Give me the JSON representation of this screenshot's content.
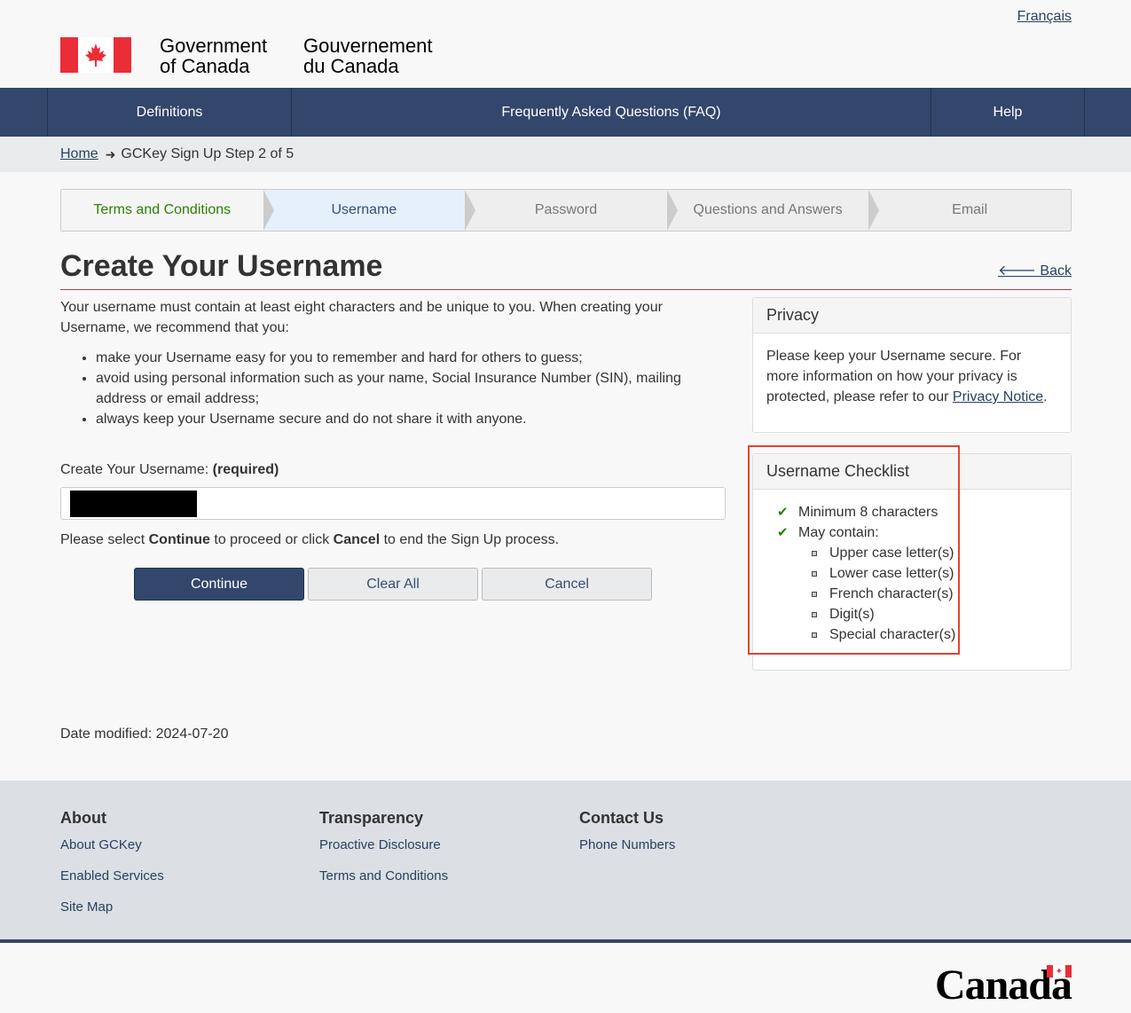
{
  "header": {
    "lang_link": "Français",
    "signature_en_line1": "Government",
    "signature_en_line2": "of Canada",
    "signature_fr_line1": "Gouvernement",
    "signature_fr_line2": "du Canada"
  },
  "nav": {
    "definitions": "Definitions",
    "faq": "Frequently Asked Questions (FAQ)",
    "help": "Help"
  },
  "breadcrumb": {
    "home": "Home",
    "current": "GCKey Sign Up Step 2 of 5"
  },
  "steps": [
    {
      "label": "Terms and Conditions",
      "state": "done"
    },
    {
      "label": "Username",
      "state": "active"
    },
    {
      "label": "Password",
      "state": "upcoming"
    },
    {
      "label": "Questions and Answers",
      "state": "upcoming"
    },
    {
      "label": "Email",
      "state": "upcoming"
    }
  ],
  "page": {
    "title": "Create Your Username",
    "back": "Back",
    "intro": "Your username must contain at least eight characters and be unique to you. When creating your Username, we recommend that you:",
    "bullets": [
      "make your Username easy for you to remember and hard for others to guess;",
      "avoid using personal information such as your name, Social Insurance Number (SIN), mailing address or email address;",
      "always keep your Username secure and do not share it with anyone."
    ],
    "field_label": "Create Your Username:",
    "field_required": "(required)",
    "instr_1": "Please select ",
    "instr_continue": "Continue",
    "instr_2": " to proceed or click ",
    "instr_cancel": "Cancel",
    "instr_3": " to end the Sign Up process.",
    "btn_continue": "Continue",
    "btn_clear": "Clear All",
    "btn_cancel": "Cancel",
    "modified_label": "Date modified:",
    "modified_date": "2024-07-20"
  },
  "privacy": {
    "title": "Privacy",
    "text": "Please keep your Username secure. For more information on how your privacy is protected, please refer to our ",
    "link": "Privacy Notice",
    "end": "."
  },
  "checklist": {
    "title": "Username Checklist",
    "items": [
      "Minimum 8 characters",
      "May contain:"
    ],
    "sub_items": [
      "Upper case letter(s)",
      "Lower case letter(s)",
      "French character(s)",
      "Digit(s)",
      "Special character(s)"
    ]
  },
  "footer": {
    "about": {
      "title": "About",
      "links": [
        "About GCKey",
        "Enabled Services",
        "Site Map"
      ]
    },
    "transparency": {
      "title": "Transparency",
      "links": [
        "Proactive Disclosure",
        "Terms and Conditions"
      ]
    },
    "contact": {
      "title": "Contact Us",
      "links": [
        "Phone Numbers"
      ]
    },
    "wordmark": "Canada"
  },
  "colors": {
    "nav_bg": "#33466b",
    "accent_red": "#eb2d37",
    "link": "#284162",
    "highlight": "#e0462d"
  }
}
